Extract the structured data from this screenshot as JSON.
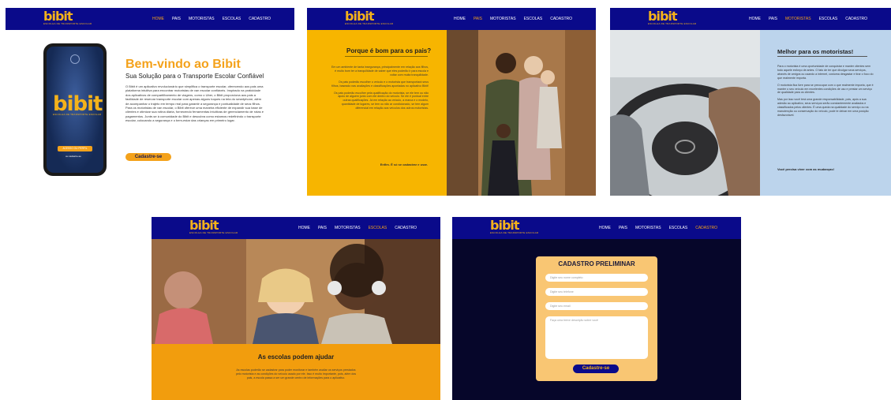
{
  "brand": {
    "name": "bibit",
    "tagline": "ESCOLHA DE TRANSPORTE ESCOLAR"
  },
  "colors": {
    "navy": "#0a0a8a",
    "orange": "#f4a21b",
    "yellow": "#f7b500",
    "light_blue": "#bcd4ec",
    "dark": "#06062a",
    "form_bg": "#f9c673"
  },
  "nav": {
    "home": "HOME",
    "pais": "PAIS",
    "motoristas": "MOTORISTAS",
    "escolas": "ESCOLAS",
    "cadastro": "CADASTRO"
  },
  "home": {
    "title": "Bem-vindo ao Bibit",
    "subtitle": "Sua Solução para o Transporte Escolar Confiável",
    "body": "O Bibit é um aplicativo revolucionário que simplifica o transporte escolar, oferecendo aos pais uma plataforma intuitiva para encontrar motoristas de van escolar confiáveis. Inspirado na praticidade dos aplicativos de compartilhamento de viagens, como o Uber, o Bibit proporciona aos pais a facilidade de reservar transporte escolar com apenas alguns toques na tela do smartphone, além de acompanhar o trajeto em tempo real para garantir a segurança e pontualidade de seus filhos. Para os motoristas de van escolar, o Bibit oferece uma maneira eficiente de expandir sua base de clientes e otimizar sua rotina diária, fornecendo ferramentas intuitivas de gerenciamento de rotas e pagamentos. Junte-se à comunidade do Bibit e descubra como estamos redefinindo o transporte escolar, colocando a segurança e o bem-estar das crianças em primeiro lugar.",
    "cta": "Cadastre-se",
    "phone_button": "ACESSO OU PERFIL",
    "phone_link": "ou cadastre-se"
  },
  "pais": {
    "title": "Porque é bom para os pais?",
    "paragraphs": [
      "Em um ambiente de tanta insegurança, principalmente em relação aos filhos, é muito bom ter a tranquilidade de saber que eles poderão ir para escola e voltar com muita tranquilidade.",
      "Os pais poderão escolher o veículo e o motorista que transportará seus filhos, baseado nas avaliações e classificações apontadas no aplicativo Bibit!",
      "Os pais poderão escolher pela qualificação do motorista, se ele tem ou não apoio de alguém junto com ele dentro do veículo. Se ele é pontual entre outras qualificações. Já em relação ao veículo, a marca e o modelo, quantidade de lugares, se tem ou não ar condicionado, se tem algum diferencial em relação aos veículos dos outros motoristas."
    ],
    "cta": "Enfim. É só se cadastrar e usar."
  },
  "motoristas": {
    "title": "Melhor para os motoristas!",
    "paragraphs": [
      "Para o motorista é uma oportunidade de conquistar e manter clientes sem todo aquele esforço de antes. O fato de ter que divulgar seus serviços, através de amigos ou usando a internet, costuma desgastar e tirar o foco do que realmente importa.",
      "O motorista fica livre para se preocupar com o que realmente importa, que é manter o seu veículo em excelentes condições de uso e prestar um serviço de qualidade para os clientes.",
      "Mas por isso você terá uma grande responsabilidade, pois, após a sua adesão ao aplicativo, seus serviços serão constantemente avaliados e classificados pelos clientes. É uma queda na qualidade do serviço ou na manutenção ou conservação do veículo, pode te deixar em uma posição desfavorável."
    ],
    "cta": "Você precisa viver com as mudanças!"
  },
  "escolas": {
    "title": "As escolas podem ajudar",
    "body": "As escolas poderão se cadastrar para poder monitorar e também avaliar os serviços prestados pelo motorista e as condições do veículo usado por ele. Isso é muito importante, pois, além dos pais, a escola passa a ser um grande centro de informações para o aplicativo."
  },
  "cadastro": {
    "title": "CADASTRO PRELIMINAR",
    "name_placeholder": "Digite seu nome completo",
    "phone_placeholder": "Digite seu telefone",
    "email_placeholder": "Digite seu email",
    "description_placeholder": "Faça uma breve descrição sobre você",
    "submit": "Cadastre-se"
  }
}
